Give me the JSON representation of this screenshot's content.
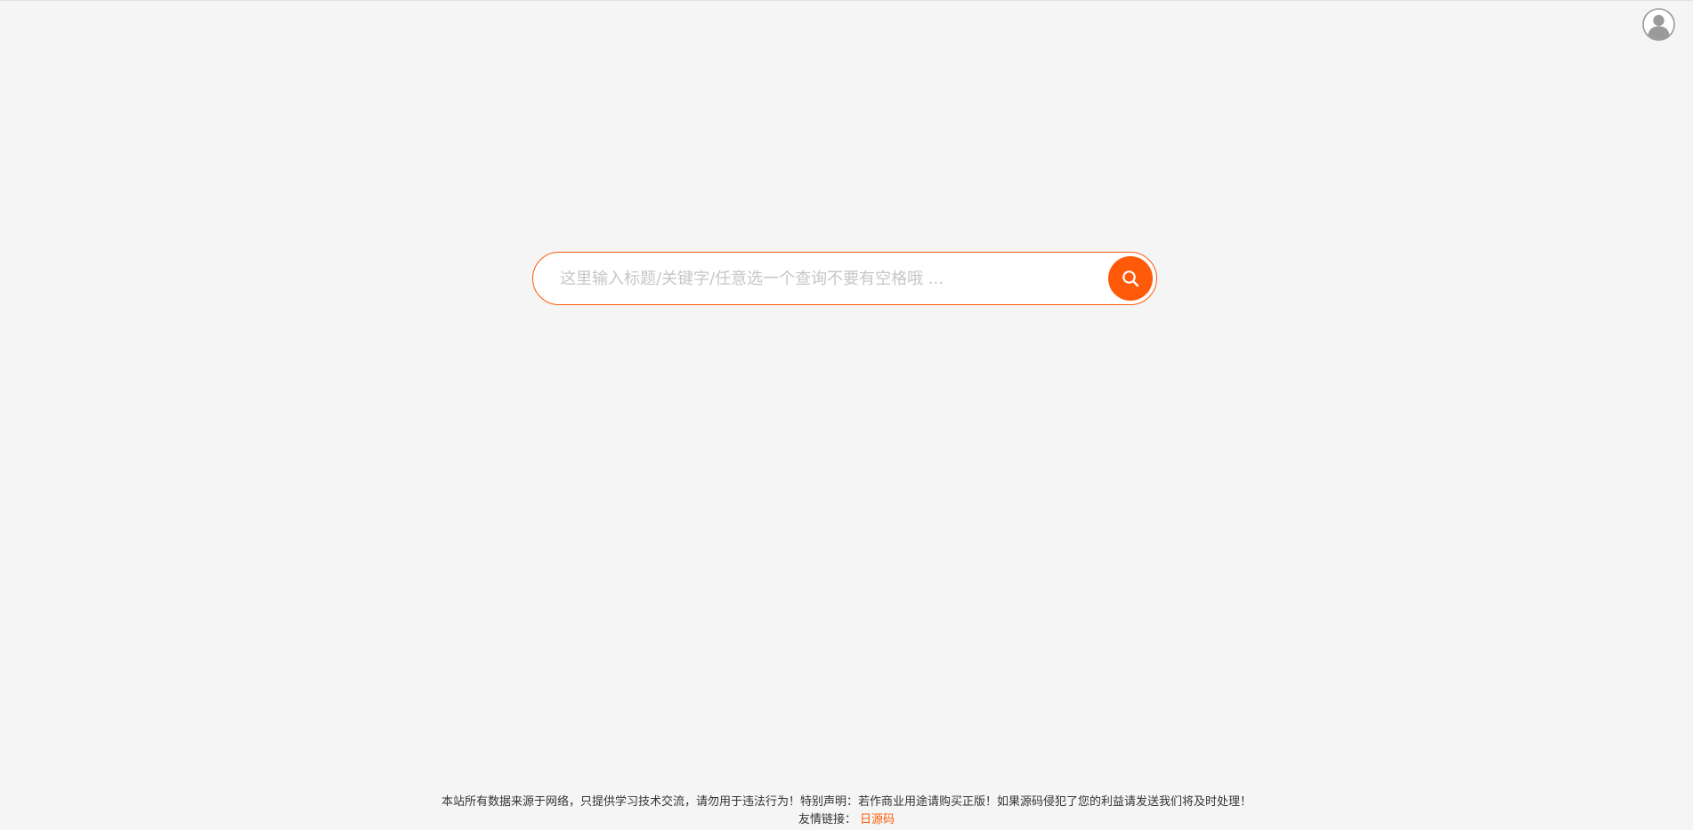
{
  "header": {
    "avatar_icon": "user-avatar-icon"
  },
  "search": {
    "placeholder": "这里输入标题/关键字/任意选一个查询不要有空格哦 ...",
    "value": "",
    "button_icon": "search-icon"
  },
  "footer": {
    "disclaimer": "本站所有数据来源于网络，只提供学习技术交流，请勿用于违法行为！特别声明：若作商业用途请购买正版！如果源码侵犯了您的利益请发送我们将及时处理！",
    "links_label": "友情链接：",
    "links": [
      {
        "label": "日源码"
      }
    ]
  },
  "colors": {
    "accent": "#ff5a0a",
    "background": "#f5f5f5",
    "placeholder": "#c6c6c6"
  }
}
